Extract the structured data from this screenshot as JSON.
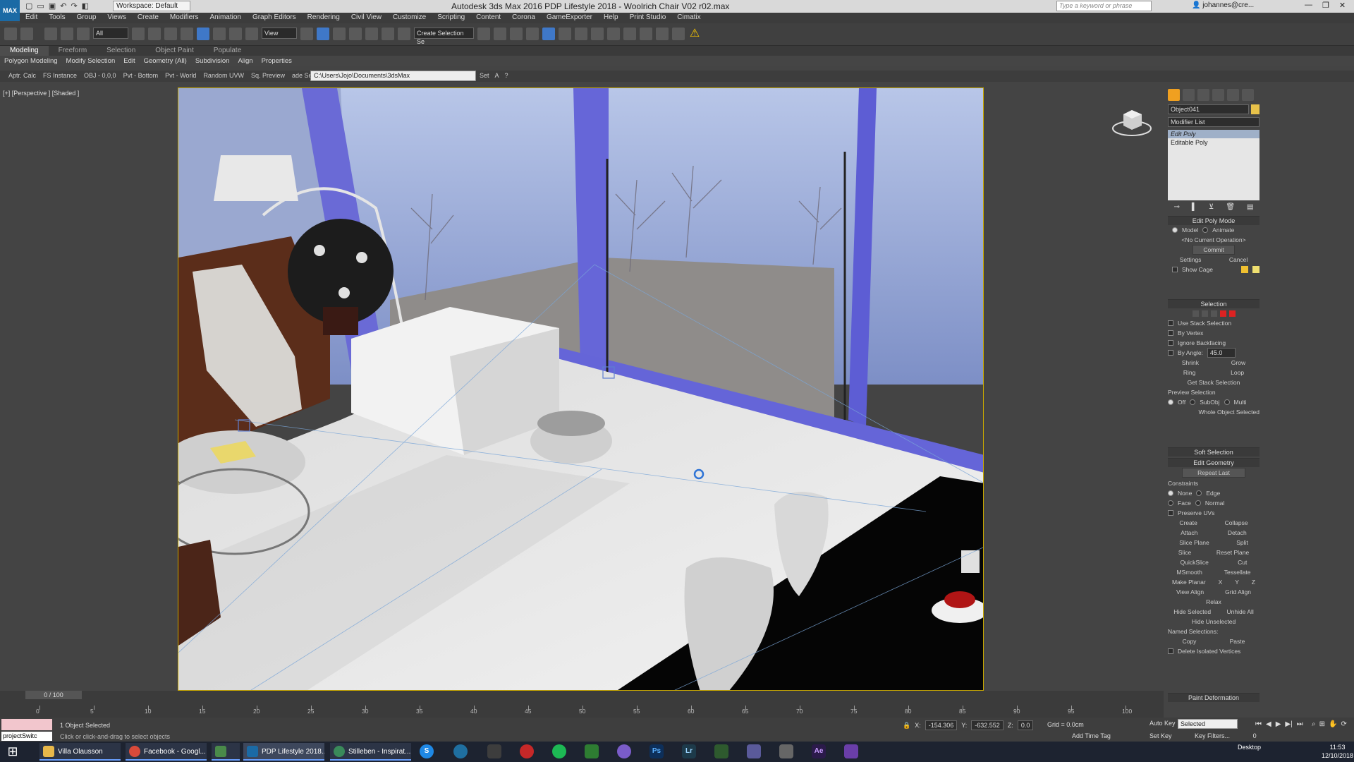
{
  "window": {
    "title": "Autodesk 3ds Max 2016    PDP Lifestyle 2018 - Woolrich Chair V02 r02.max",
    "workspace": "Workspace: Default",
    "search_placeholder": "Type a keyword or phrase",
    "user": "johannes@cre..."
  },
  "menu": [
    "Edit",
    "Tools",
    "Group",
    "Views",
    "Create",
    "Modifiers",
    "Animation",
    "Graph Editors",
    "Rendering",
    "Civil View",
    "Customize",
    "Scripting",
    "Content",
    "Corona",
    "GameExporter",
    "Help",
    "Print Studio",
    "Cimatix"
  ],
  "toolbar": {
    "filter": "All",
    "refcoord": "View",
    "named_selection": "Create Selection Se"
  },
  "ribbon": {
    "tabs": [
      "Modeling",
      "Freeform",
      "Selection",
      "Object Paint",
      "Populate"
    ],
    "subtabs": [
      "Polygon Modeling",
      "Modify Selection",
      "Edit",
      "Geometry (All)",
      "Subdivision",
      "Align",
      "Properties"
    ],
    "row3": [
      "Aptr. Calc",
      "FS Instance",
      "OBJ - 0,0,0",
      "Pvt - Bottom",
      "Pvt - World",
      "Random UVW",
      "Sq. Preview",
      "ade Selected"
    ],
    "path": "C:\\Users\\Jojo\\Documents\\3dsMax",
    "path_set": "Set",
    "path_a": "A",
    "path_q": "?"
  },
  "viewport": {
    "label": "[+] [Perspective ] [Shaded ]"
  },
  "command_panel": {
    "object_name": "Object041",
    "modifier_list": "Modifier List",
    "stack": [
      "Edit Poly",
      "Editable Poly"
    ],
    "edit_poly_mode": {
      "title": "Edit Poly Mode",
      "model": "Model",
      "animate": "Animate",
      "current_op": "<No Current Operation>",
      "commit": "Commit",
      "settings": "Settings",
      "cancel": "Cancel",
      "show_cage": "Show Cage"
    },
    "selection": {
      "title": "Selection",
      "use_stack": "Use Stack Selection",
      "by_vertex": "By Vertex",
      "ignore_backfacing": "Ignore Backfacing",
      "by_angle": "By Angle:",
      "angle_value": "45.0",
      "shrink": "Shrink",
      "grow": "Grow",
      "ring": "Ring",
      "loop": "Loop",
      "get_stack": "Get Stack Selection",
      "preview": "Preview Selection",
      "off": "Off",
      "subobj": "SubObj",
      "multi": "Multi",
      "status": "Whole Object Selected"
    },
    "soft_selection": "Soft Selection",
    "edit_geometry": {
      "title": "Edit Geometry",
      "repeat_last": "Repeat Last",
      "constraints": "Constraints",
      "none": "None",
      "edge": "Edge",
      "face": "Face",
      "normal": "Normal",
      "preserve_uvs": "Preserve UVs",
      "create": "Create",
      "collapse": "Collapse",
      "attach": "Attach",
      "detach": "Detach",
      "slice_plane": "Slice Plane",
      "split": "Split",
      "slice": "Slice",
      "reset_plane": "Reset Plane",
      "quickslice": "QuickSlice",
      "cut": "Cut",
      "msmooth": "MSmooth",
      "tessellate": "Tessellate",
      "make_planar": "Make Planar",
      "x": "X",
      "y": "Y",
      "z": "Z",
      "view_align": "View Align",
      "grid_align": "Grid Align",
      "relax": "Relax",
      "hide_selected": "Hide Selected",
      "unhide_all": "Unhide All",
      "hide_unselected": "Hide Unselected",
      "named_selections": "Named Selections:",
      "copy": "Copy",
      "paste": "Paste",
      "delete_isolated": "Delete Isolated Vertices"
    },
    "paint_deformation": "Paint Deformation"
  },
  "timeline": {
    "slider": "0 / 100",
    "ticks": [
      "0",
      "5",
      "10",
      "15",
      "20",
      "25",
      "30",
      "35",
      "40",
      "45",
      "50",
      "55",
      "60",
      "65",
      "70",
      "75",
      "80",
      "85",
      "90",
      "95",
      "100"
    ]
  },
  "status": {
    "maxscript": "projectSwitc",
    "selection": "1 Object Selected",
    "prompt": "Click or click-and-drag to select objects",
    "x": "-154.306",
    "y": "-632.552",
    "z": "0.0",
    "grid": "Grid = 0.0cm",
    "add_time_tag": "Add Time Tag",
    "auto_key": "Auto Key",
    "set_key": "Set Key",
    "key_mode": "Selected",
    "key_filters": "Key Filters...",
    "frame": "0"
  },
  "taskbar": {
    "items": [
      "Villa Olausson",
      "Facebook - Googl...",
      "PDP Lifestyle 2018...",
      "Stilleben - Inspirat..."
    ],
    "apps": [
      "S",
      "Ps",
      "Lr",
      "Ae"
    ],
    "tray": "Desktop",
    "time": "11:53",
    "date": "12/10/2018"
  }
}
